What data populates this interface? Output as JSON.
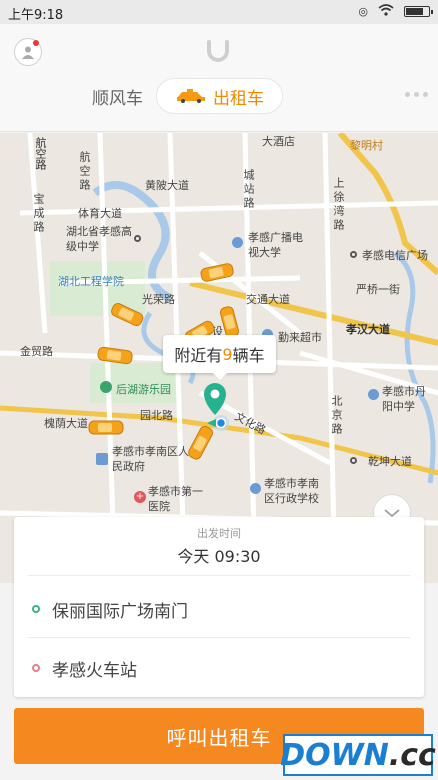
{
  "status_bar": {
    "time": "上午9:18"
  },
  "header": {
    "tabs": [
      {
        "label": "顺风车",
        "active": false
      },
      {
        "label": "出租车",
        "active": true
      }
    ],
    "accent_color": "#f08a00"
  },
  "map": {
    "poi_labels": [
      "航空路",
      "黄陂大道",
      "城站路",
      "大酒店",
      "黎明村",
      "宝成路",
      "体育大道",
      "湖北省孝感高级中学",
      "孝感广播电视大学",
      "上徐湾路",
      "孝感电信广场",
      "湖北工程学院",
      "严桥一街",
      "光荣路",
      "交通大道",
      "勤来超市",
      "孝汉大道",
      "金贸路",
      "后湖游乐园",
      "孝感市丹阳中学",
      "园北路",
      "北京路",
      "文化路",
      "槐荫大道",
      "孝感市孝南区人民政府",
      "乾坤大道",
      "孝感市第一医院",
      "孝感市孝南区行政学校",
      "设"
    ],
    "nearby_prefix": "附近有",
    "nearby_count": "9",
    "nearby_suffix": "辆车"
  },
  "trip": {
    "depart_label": "出发时间",
    "depart_time": "今天 09:30",
    "from": "保丽国际广场南门",
    "to": "孝感火车站"
  },
  "call_button": "呼叫出租车",
  "watermark": {
    "part1": "DOWN",
    "part2": ".cc"
  },
  "colors": {
    "call_button": "#f5891f",
    "pin": "#26b28f",
    "from_dot": "#36b37e",
    "to_dot": "#e67b8a",
    "taxi": "#f5a21b"
  }
}
